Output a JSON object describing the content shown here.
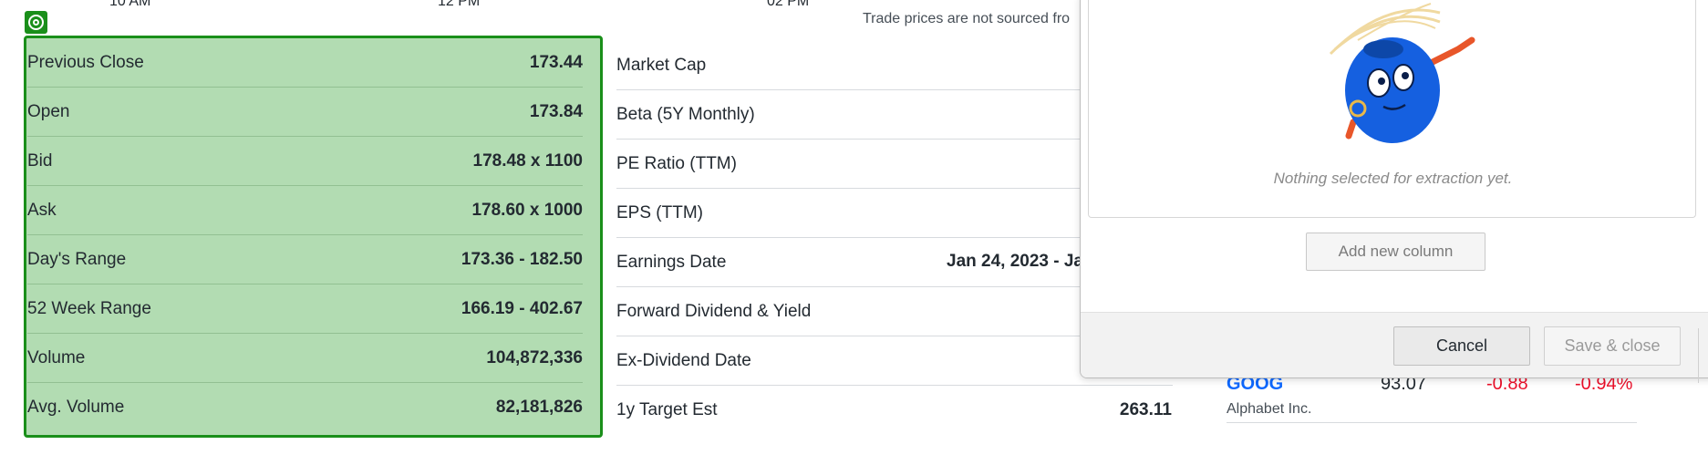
{
  "chart_axis": [
    "10 AM",
    "12 PM",
    "02 PM"
  ],
  "trade_note": "Trade prices are not sourced fro",
  "summary_left": [
    {
      "label": "Previous Close",
      "value": "173.44"
    },
    {
      "label": "Open",
      "value": "173.84"
    },
    {
      "label": "Bid",
      "value": "178.48 x 1100"
    },
    {
      "label": "Ask",
      "value": "178.60 x 1000"
    },
    {
      "label": "Day's Range",
      "value": "173.36 - 182.50"
    },
    {
      "label": "52 Week Range",
      "value": "166.19 - 402.67"
    },
    {
      "label": "Volume",
      "value": "104,872,336"
    },
    {
      "label": "Avg. Volume",
      "value": "82,181,826"
    }
  ],
  "summary_right": [
    {
      "label": "Market Cap"
    },
    {
      "label": "Beta (5Y Monthly)"
    },
    {
      "label": "PE Ratio (TTM)"
    },
    {
      "label": "EPS (TTM)"
    },
    {
      "label": "Earnings Date",
      "value": "Jan 24, 2023 - Ja"
    },
    {
      "label": "Forward Dividend & Yield"
    },
    {
      "label": "Ex-Dividend Date"
    },
    {
      "label": "1y Target Est",
      "value": "263.11"
    }
  ],
  "ticker": {
    "symbol": "GOOG",
    "price": "93.07",
    "change": "-0.88",
    "change_pct": "-0.94%",
    "name": "Alphabet Inc."
  },
  "modal": {
    "empty_text": "Nothing selected for extraction yet.",
    "add_column_label": "Add new column",
    "cancel_label": "Cancel",
    "save_label": "Save & close"
  },
  "colors": {
    "selection_fill": "#b2dcb2",
    "selection_border": "#1a8f1a",
    "link_blue": "#0f69ff",
    "negative_red": "#eb0f29"
  },
  "icons": [
    "target-icon",
    "mascot-illustration"
  ]
}
